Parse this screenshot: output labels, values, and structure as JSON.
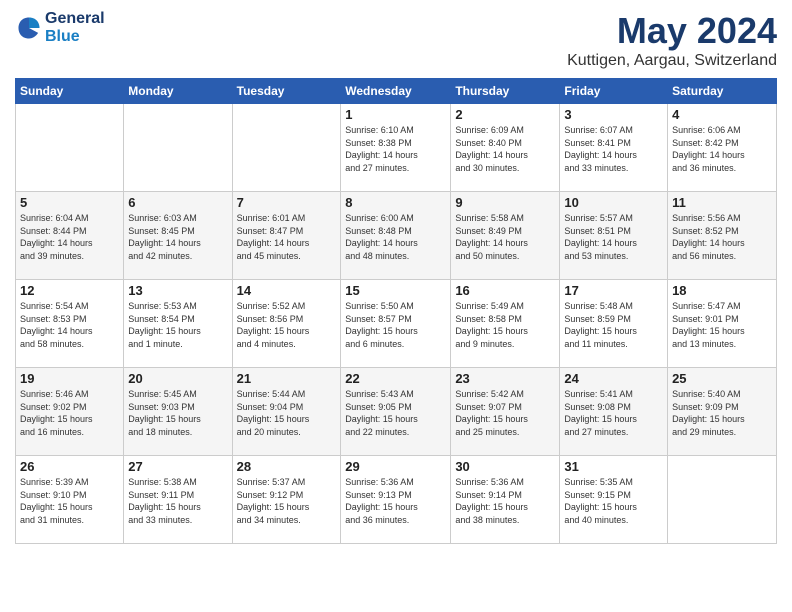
{
  "header": {
    "logo": {
      "line1": "General",
      "line2": "Blue"
    },
    "title": "May 2024",
    "subtitle": "Kuttigen, Aargau, Switzerland"
  },
  "weekdays": [
    "Sunday",
    "Monday",
    "Tuesday",
    "Wednesday",
    "Thursday",
    "Friday",
    "Saturday"
  ],
  "weeks": [
    [
      {
        "day": "",
        "info": ""
      },
      {
        "day": "",
        "info": ""
      },
      {
        "day": "",
        "info": ""
      },
      {
        "day": "1",
        "info": "Sunrise: 6:10 AM\nSunset: 8:38 PM\nDaylight: 14 hours\nand 27 minutes."
      },
      {
        "day": "2",
        "info": "Sunrise: 6:09 AM\nSunset: 8:40 PM\nDaylight: 14 hours\nand 30 minutes."
      },
      {
        "day": "3",
        "info": "Sunrise: 6:07 AM\nSunset: 8:41 PM\nDaylight: 14 hours\nand 33 minutes."
      },
      {
        "day": "4",
        "info": "Sunrise: 6:06 AM\nSunset: 8:42 PM\nDaylight: 14 hours\nand 36 minutes."
      }
    ],
    [
      {
        "day": "5",
        "info": "Sunrise: 6:04 AM\nSunset: 8:44 PM\nDaylight: 14 hours\nand 39 minutes."
      },
      {
        "day": "6",
        "info": "Sunrise: 6:03 AM\nSunset: 8:45 PM\nDaylight: 14 hours\nand 42 minutes."
      },
      {
        "day": "7",
        "info": "Sunrise: 6:01 AM\nSunset: 8:47 PM\nDaylight: 14 hours\nand 45 minutes."
      },
      {
        "day": "8",
        "info": "Sunrise: 6:00 AM\nSunset: 8:48 PM\nDaylight: 14 hours\nand 48 minutes."
      },
      {
        "day": "9",
        "info": "Sunrise: 5:58 AM\nSunset: 8:49 PM\nDaylight: 14 hours\nand 50 minutes."
      },
      {
        "day": "10",
        "info": "Sunrise: 5:57 AM\nSunset: 8:51 PM\nDaylight: 14 hours\nand 53 minutes."
      },
      {
        "day": "11",
        "info": "Sunrise: 5:56 AM\nSunset: 8:52 PM\nDaylight: 14 hours\nand 56 minutes."
      }
    ],
    [
      {
        "day": "12",
        "info": "Sunrise: 5:54 AM\nSunset: 8:53 PM\nDaylight: 14 hours\nand 58 minutes."
      },
      {
        "day": "13",
        "info": "Sunrise: 5:53 AM\nSunset: 8:54 PM\nDaylight: 15 hours\nand 1 minute."
      },
      {
        "day": "14",
        "info": "Sunrise: 5:52 AM\nSunset: 8:56 PM\nDaylight: 15 hours\nand 4 minutes."
      },
      {
        "day": "15",
        "info": "Sunrise: 5:50 AM\nSunset: 8:57 PM\nDaylight: 15 hours\nand 6 minutes."
      },
      {
        "day": "16",
        "info": "Sunrise: 5:49 AM\nSunset: 8:58 PM\nDaylight: 15 hours\nand 9 minutes."
      },
      {
        "day": "17",
        "info": "Sunrise: 5:48 AM\nSunset: 8:59 PM\nDaylight: 15 hours\nand 11 minutes."
      },
      {
        "day": "18",
        "info": "Sunrise: 5:47 AM\nSunset: 9:01 PM\nDaylight: 15 hours\nand 13 minutes."
      }
    ],
    [
      {
        "day": "19",
        "info": "Sunrise: 5:46 AM\nSunset: 9:02 PM\nDaylight: 15 hours\nand 16 minutes."
      },
      {
        "day": "20",
        "info": "Sunrise: 5:45 AM\nSunset: 9:03 PM\nDaylight: 15 hours\nand 18 minutes."
      },
      {
        "day": "21",
        "info": "Sunrise: 5:44 AM\nSunset: 9:04 PM\nDaylight: 15 hours\nand 20 minutes."
      },
      {
        "day": "22",
        "info": "Sunrise: 5:43 AM\nSunset: 9:05 PM\nDaylight: 15 hours\nand 22 minutes."
      },
      {
        "day": "23",
        "info": "Sunrise: 5:42 AM\nSunset: 9:07 PM\nDaylight: 15 hours\nand 25 minutes."
      },
      {
        "day": "24",
        "info": "Sunrise: 5:41 AM\nSunset: 9:08 PM\nDaylight: 15 hours\nand 27 minutes."
      },
      {
        "day": "25",
        "info": "Sunrise: 5:40 AM\nSunset: 9:09 PM\nDaylight: 15 hours\nand 29 minutes."
      }
    ],
    [
      {
        "day": "26",
        "info": "Sunrise: 5:39 AM\nSunset: 9:10 PM\nDaylight: 15 hours\nand 31 minutes."
      },
      {
        "day": "27",
        "info": "Sunrise: 5:38 AM\nSunset: 9:11 PM\nDaylight: 15 hours\nand 33 minutes."
      },
      {
        "day": "28",
        "info": "Sunrise: 5:37 AM\nSunset: 9:12 PM\nDaylight: 15 hours\nand 34 minutes."
      },
      {
        "day": "29",
        "info": "Sunrise: 5:36 AM\nSunset: 9:13 PM\nDaylight: 15 hours\nand 36 minutes."
      },
      {
        "day": "30",
        "info": "Sunrise: 5:36 AM\nSunset: 9:14 PM\nDaylight: 15 hours\nand 38 minutes."
      },
      {
        "day": "31",
        "info": "Sunrise: 5:35 AM\nSunset: 9:15 PM\nDaylight: 15 hours\nand 40 minutes."
      },
      {
        "day": "",
        "info": ""
      }
    ]
  ]
}
